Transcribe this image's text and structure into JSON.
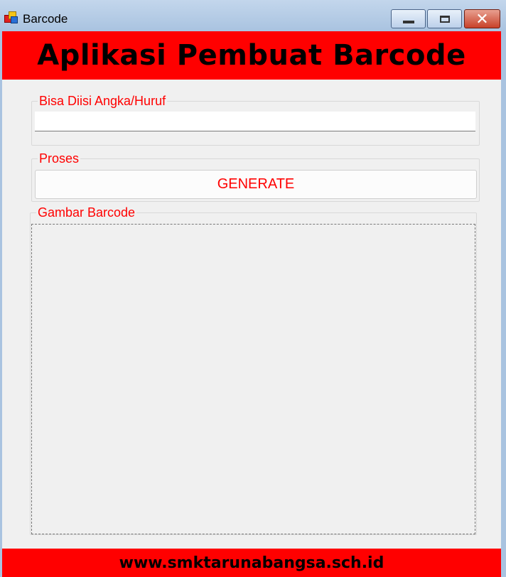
{
  "window": {
    "title": "Barcode",
    "icon": "app-windows-icon",
    "controls": {
      "minimize": "minimize-icon",
      "maximize": "maximize-icon",
      "close": "close-icon"
    }
  },
  "header": {
    "title": "Aplikasi Pembuat Barcode"
  },
  "input_group": {
    "title": "Bisa Diisi Angka/Huruf",
    "value": "",
    "placeholder": ""
  },
  "process_group": {
    "title": "Proses",
    "button_label": "GENERATE"
  },
  "barcode_group": {
    "title": "Gambar Barcode"
  },
  "footer": {
    "text": "www.smktarunabangsa.sch.id"
  },
  "colors": {
    "accent": "#ff0000",
    "background": "#f0f0f0",
    "titlebar": "#a9c3e0"
  }
}
